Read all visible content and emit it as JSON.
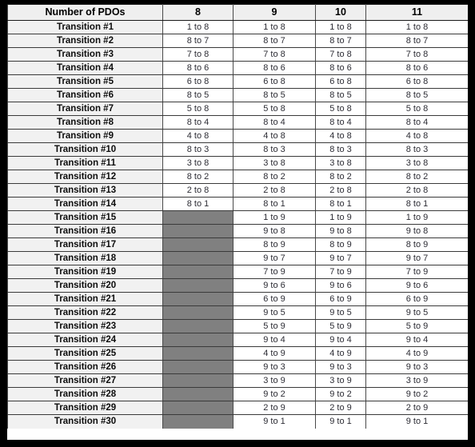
{
  "table": {
    "title_cell": "Number of PDOs",
    "columns": [
      "8",
      "9",
      "10",
      "11"
    ],
    "blocked_placeholder": "",
    "rows": [
      {
        "label": "Transition #1",
        "values": [
          "1 to 8",
          "1 to 8",
          "1 to 8",
          "1 to 8"
        ]
      },
      {
        "label": "Transition #2",
        "values": [
          "8 to 7",
          "8 to 7",
          "8 to 7",
          "8 to 7"
        ]
      },
      {
        "label": "Transition #3",
        "values": [
          "7 to 8",
          "7 to 8",
          "7 to 8",
          "7 to 8"
        ]
      },
      {
        "label": "Transition #4",
        "values": [
          "8 to 6",
          "8 to 6",
          "8 to 6",
          "8 to 6"
        ]
      },
      {
        "label": "Transition #5",
        "values": [
          "6 to 8",
          "6 to 8",
          "6 to 8",
          "6 to 8"
        ]
      },
      {
        "label": "Transition #6",
        "values": [
          "8 to 5",
          "8 to 5",
          "8 to 5",
          "8 to 5"
        ]
      },
      {
        "label": "Transition #7",
        "values": [
          "5 to 8",
          "5 to 8",
          "5 to 8",
          "5 to 8"
        ]
      },
      {
        "label": "Transition #8",
        "values": [
          "8 to 4",
          "8 to 4",
          "8 to 4",
          "8 to 4"
        ]
      },
      {
        "label": "Transition #9",
        "values": [
          "4 to 8",
          "4 to 8",
          "4 to 8",
          "4 to 8"
        ]
      },
      {
        "label": "Transition #10",
        "values": [
          "8 to 3",
          "8 to 3",
          "8 to 3",
          "8 to 3"
        ]
      },
      {
        "label": "Transition #11",
        "values": [
          "3 to 8",
          "3 to 8",
          "3 to 8",
          "3 to 8"
        ]
      },
      {
        "label": "Transition #12",
        "values": [
          "8 to 2",
          "8 to 2",
          "8 to 2",
          "8 to 2"
        ]
      },
      {
        "label": "Transition #13",
        "values": [
          "2 to 8",
          "2 to 8",
          "2 to 8",
          "2 to 8"
        ]
      },
      {
        "label": "Transition #14",
        "values": [
          "8 to 1",
          "8 to 1",
          "8 to 1",
          "8 to 1"
        ]
      },
      {
        "label": "Transition #15",
        "values": [
          null,
          "1 to 9",
          "1 to 9",
          "1 to 9"
        ]
      },
      {
        "label": "Transition #16",
        "values": [
          null,
          "9 to 8",
          "9 to 8",
          "9 to 8"
        ]
      },
      {
        "label": "Transition #17",
        "values": [
          null,
          "8 to 9",
          "8 to 9",
          "8 to 9"
        ]
      },
      {
        "label": "Transition #18",
        "values": [
          null,
          "9 to 7",
          "9 to 7",
          "9 to 7"
        ]
      },
      {
        "label": "Transition #19",
        "values": [
          null,
          "7 to 9",
          "7 to 9",
          "7 to 9"
        ]
      },
      {
        "label": "Transition #20",
        "values": [
          null,
          "9 to 6",
          "9 to 6",
          "9 to 6"
        ]
      },
      {
        "label": "Transition #21",
        "values": [
          null,
          "6 to 9",
          "6 to 9",
          "6 to 9"
        ]
      },
      {
        "label": "Transition #22",
        "values": [
          null,
          "9 to 5",
          "9 to 5",
          "9 to 5"
        ]
      },
      {
        "label": "Transition #23",
        "values": [
          null,
          "5 to 9",
          "5 to 9",
          "5 to 9"
        ]
      },
      {
        "label": "Transition #24",
        "values": [
          null,
          "9 to 4",
          "9 to 4",
          "9 to 4"
        ]
      },
      {
        "label": "Transition #25",
        "values": [
          null,
          "4 to 9",
          "4 to 9",
          "4 to 9"
        ]
      },
      {
        "label": "Transition #26",
        "values": [
          null,
          "9 to 3",
          "9 to 3",
          "9 to 3"
        ]
      },
      {
        "label": "Transition #27",
        "values": [
          null,
          "3 to 9",
          "3 to 9",
          "3 to 9"
        ]
      },
      {
        "label": "Transition #28",
        "values": [
          null,
          "9 to 2",
          "9 to 2",
          "9 to 2"
        ]
      },
      {
        "label": "Transition #29",
        "values": [
          null,
          "2 to 9",
          "2 to 9",
          "2 to 9"
        ]
      },
      {
        "label": "Transition #30",
        "values": [
          null,
          "9 to 1",
          "9 to 1",
          "9 to 1"
        ]
      }
    ]
  },
  "colors": {
    "frame": "#000000",
    "header_bg": "#efefef",
    "label_bg": "#f1f1f1",
    "data_bg": "#ffffff",
    "blocked_bg": "#808080",
    "grid": "#3a3a3a",
    "data_text": "#2c2c34",
    "label_text": "#0d0d0d"
  }
}
